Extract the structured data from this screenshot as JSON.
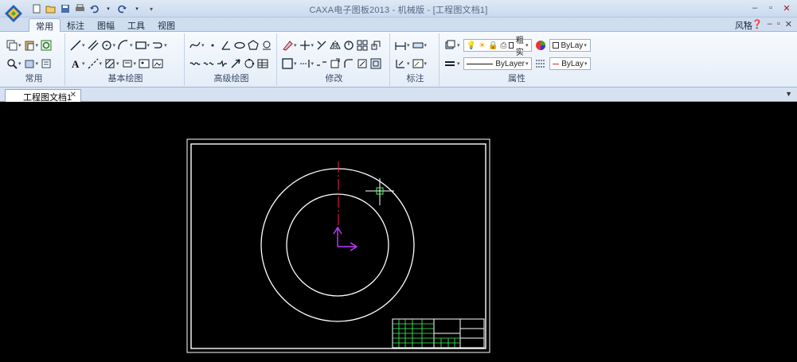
{
  "window": {
    "title": "CAXA电子图板2013 - 机械版 - [工程图文档1]",
    "style_menu": "风格"
  },
  "ribbon_tabs": [
    "常用",
    "标注",
    "图幅",
    "工具",
    "视图"
  ],
  "ribbon": {
    "groups": [
      "常用",
      "基本绘图",
      "高级绘图",
      "修改",
      "标注",
      "属性"
    ],
    "properties": {
      "linewidth": "粗实",
      "color": "ByLay",
      "linetype": "ByLayer",
      "linetype2": "ByLay"
    }
  },
  "document": {
    "tab_label": "工程图文档1"
  },
  "colors": {
    "canvas": "#000000",
    "frame": "#ffffff",
    "centerline": "#ff2040",
    "ucs": "#c040ff",
    "title_block_text": "#40ff60"
  }
}
